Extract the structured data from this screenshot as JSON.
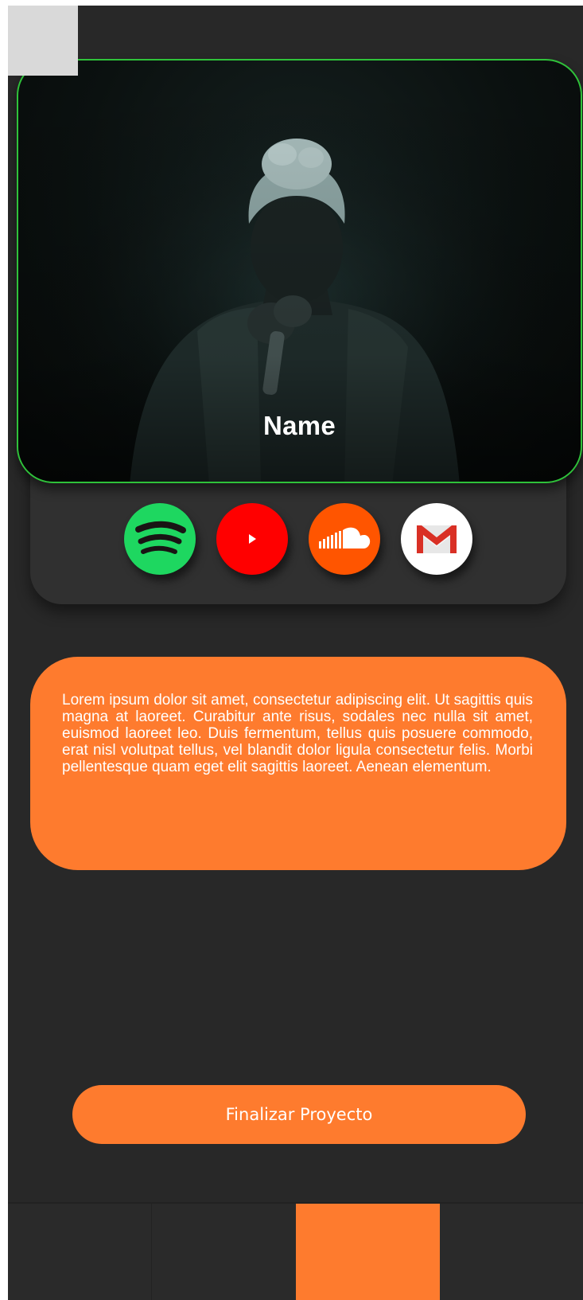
{
  "profile": {
    "name": "Name"
  },
  "social": [
    {
      "id": "spotify",
      "icon": "spotify-icon",
      "color": "#1ed760"
    },
    {
      "id": "youtube",
      "icon": "youtube-icon",
      "color": "#ff0000"
    },
    {
      "id": "soundcloud",
      "icon": "soundcloud-icon",
      "color": "#ff5500"
    },
    {
      "id": "gmail",
      "icon": "gmail-icon",
      "color": "#ffffff"
    }
  ],
  "bio": {
    "text": "Lorem ipsum dolor sit amet, consectetur adipiscing elit. Ut sagittis quis magna at laoreet. Curabitur ante risus, sodales nec nulla sit amet, euismod laoreet leo. Duis fermentum, tellus quis posuere commodo, erat nisl volutpat tellus, vel blandit dolor ligula consectetur felis. Morbi pellentesque quam eget elit sagittis laoreet. Aenean elementum."
  },
  "actions": {
    "finish_label": "Finalizar Proyecto"
  },
  "theme": {
    "background": "#282828",
    "accent": "#fe7b2e",
    "hero_border": "#2fc23a"
  },
  "nav": {
    "active_index": 2
  }
}
